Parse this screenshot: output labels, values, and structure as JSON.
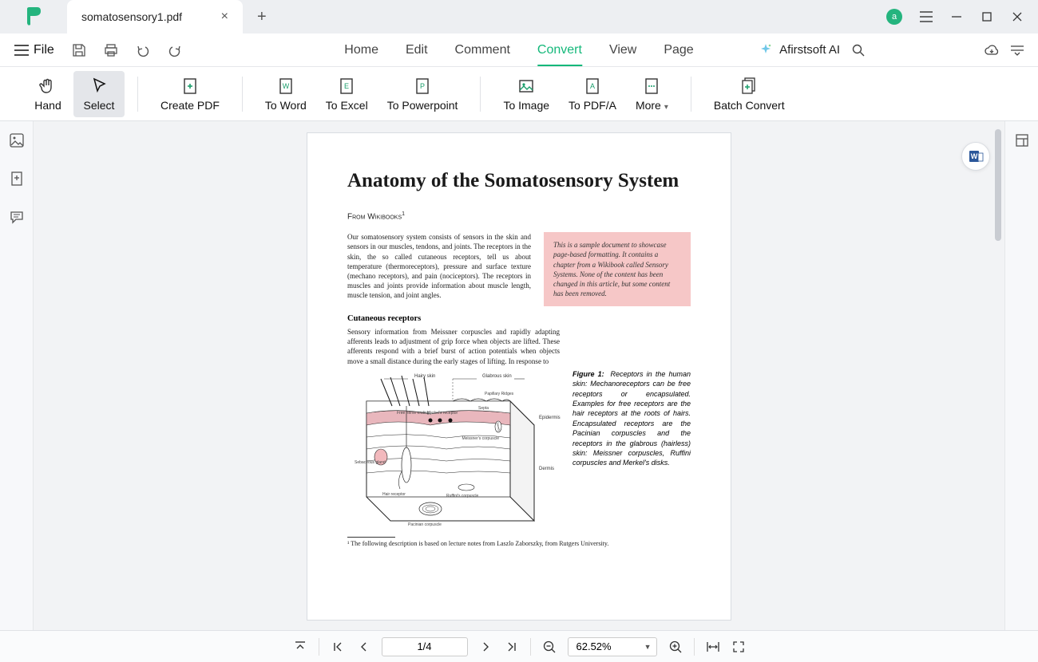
{
  "titlebar": {
    "tab_title": "somatosensory1.pdf",
    "avatar_letter": "a"
  },
  "menubar": {
    "file_label": "File",
    "tabs": {
      "home": "Home",
      "edit": "Edit",
      "comment": "Comment",
      "convert": "Convert",
      "view": "View",
      "page": "Page"
    },
    "ai_label": "Afirstsoft AI"
  },
  "ribbon": {
    "hand": "Hand",
    "select": "Select",
    "create_pdf": "Create PDF",
    "to_word": "To Word",
    "to_excel": "To Excel",
    "to_powerpoint": "To Powerpoint",
    "to_image": "To Image",
    "to_pdfa": "To PDF/A",
    "more": "More",
    "batch": "Batch Convert"
  },
  "statusbar": {
    "page_value": "1/4",
    "zoom_value": "62.52%"
  },
  "doc": {
    "title": "Anatomy of the Somatosensory System",
    "from": "From Wikibooks",
    "p1": "Our somatosensory system consists of sensors in the skin and sensors in our muscles, tendons, and joints. The receptors in the skin, the so called cutaneous receptors, tell us about temperature (thermoreceptors), pressure and surface texture (mechano receptors), and pain (nociceptors). The receptors in muscles and joints provide information about muscle length, muscle tension, and joint angles.",
    "callout": "This is a sample document to showcase page-based formatting. It contains a chapter from a Wikibook called Sensory Systems. None of the content has been changed in this article, but some content has been removed.",
    "h3": "Cutaneous receptors",
    "p2": "Sensory information from Meissner corpuscles and rapidly adapting afferents leads to adjustment of grip force when objects are lifted. These afferents respond with a brief burst of action potentials when objects move a small distance during the early stages of lifting. In response to",
    "figcap_lead": "Figure 1:",
    "figcap": "Receptors in the human skin: Mechanoreceptors can be free receptors or encapsulated. Examples for free receptors are the hair receptors at the roots of hairs. Encapsulated receptors are the Pacinian corpuscles and the receptors in the glabrous (hairless) skin: Meissner corpuscles, Ruffini corpuscles and Merkel's disks.",
    "footnote": "¹ The following description is based on lecture notes from Laszlo Zaborszky, from Rutgers University.",
    "labels": {
      "hairy": "Hairy skin",
      "glabrous": "Glabrous skin",
      "epidermis": "Epidermis",
      "dermis": "Dermis",
      "papillary": "Papillary Ridges",
      "septa": "Septa",
      "free": "Free nerve ending",
      "merkel": "Merkel's receptor",
      "meissner": "Meissner's corpuscle",
      "seb": "Sebaceous gland",
      "hairrec": "Hair receptor",
      "pacinian": "Pacinian corpuscle",
      "ruffini": "Ruffini's corpuscle"
    }
  }
}
